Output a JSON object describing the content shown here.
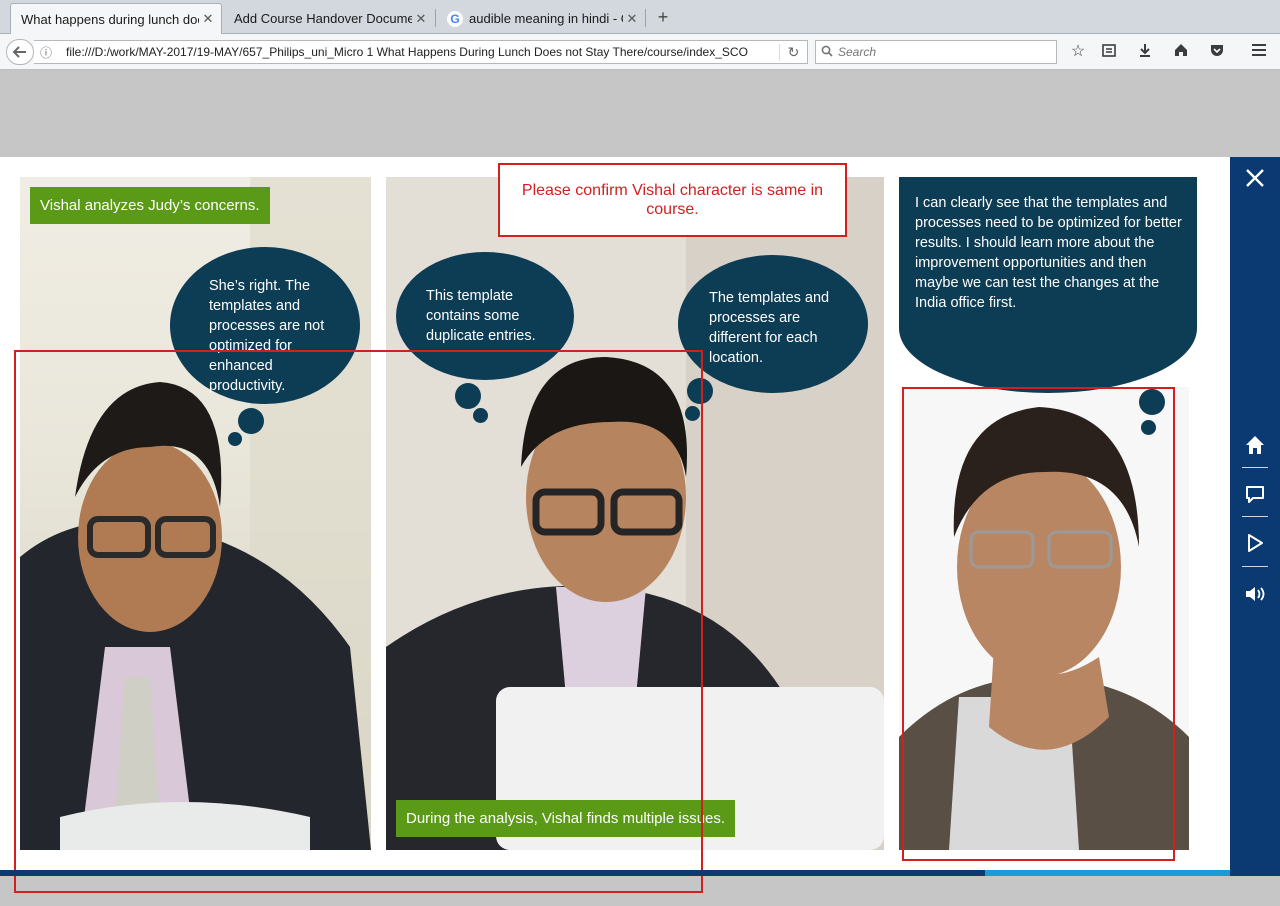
{
  "browser": {
    "tabs": [
      {
        "label": "What happens during lunch does",
        "active": true
      },
      {
        "label": "Add Course Handover Document",
        "active": false
      },
      {
        "label": "audible meaning in hindi - G",
        "active": false
      }
    ],
    "url": "file:///D:/work/MAY-2017/19-MAY/657_Philips_uni_Micro 1 What Happens During Lunch Does not Stay There/course/index_SCO",
    "search_placeholder": "Search",
    "new_tab_symbol": "+",
    "close_symbol": "✕"
  },
  "slide": {
    "caption_top": "Vishal analyzes Judy’s concerns.",
    "caption_bottom": "During the analysis, Vishal finds multiple issues.",
    "bubble_1": "She’s right. The templates and processes are not optimized for enhanced productivity.",
    "bubble_2": "This template contains some duplicate entries.",
    "bubble_3": "The templates and processes are different for each location.",
    "bubble_4": "I can clearly see that the templates and processes need to be optimized for better results. I should learn more about the improvement opportunities and then maybe we can test the changes at the India office first.",
    "review_note": "Please confirm Vishal character is same in course."
  },
  "colors": {
    "navy": "#0b3a73",
    "bubble": "#0d3c55",
    "caption_green": "#5a9a16",
    "review_red": "#d21f1f",
    "progress_light": "#1a9ad6"
  },
  "icons": {
    "close": "close-icon",
    "home": "home-icon",
    "transcript": "speech-bubble-icon",
    "play": "play-icon",
    "audio": "speaker-icon"
  }
}
